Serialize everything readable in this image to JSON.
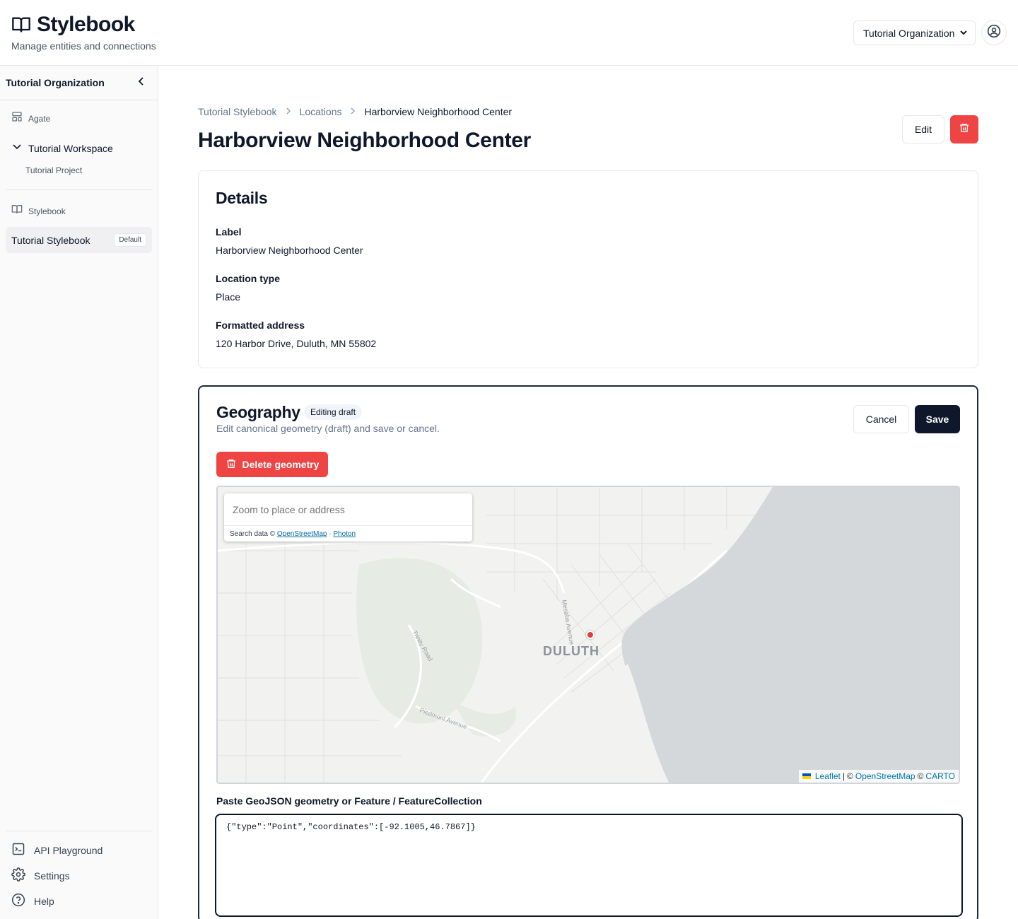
{
  "header": {
    "app_title": "Stylebook",
    "app_subtitle": "Manage entities and connections",
    "org_select_value": "Tutorial Organization"
  },
  "sidebar": {
    "org_name": "Tutorial Organization",
    "agate_label": "Agate",
    "workspace_label": "Tutorial Workspace",
    "project_label": "Tutorial Project",
    "stylebook_label": "Stylebook",
    "active_stylebook": "Tutorial Stylebook",
    "active_badge": "Default",
    "bottom_nav": [
      {
        "label": "API Playground",
        "icon": "terminal-icon"
      },
      {
        "label": "Settings",
        "icon": "gear-icon"
      },
      {
        "label": "Help",
        "icon": "help-icon"
      }
    ]
  },
  "breadcrumb": [
    "Tutorial Stylebook",
    "Locations",
    "Harborview Neighborhood Center"
  ],
  "page": {
    "title": "Harborview Neighborhood Center",
    "edit_label": "Edit"
  },
  "details": {
    "title": "Details",
    "fields": [
      {
        "label": "Label",
        "value": "Harborview Neighborhood Center"
      },
      {
        "label": "Location type",
        "value": "Place"
      },
      {
        "label": "Formatted address",
        "value": "120 Harbor Drive, Duluth, MN 55802"
      }
    ]
  },
  "geography": {
    "title": "Geography",
    "badge": "Editing draft",
    "subtitle": "Edit canonical geometry (draft) and save or cancel.",
    "cancel_label": "Cancel",
    "save_label": "Save",
    "delete_label": "Delete geometry",
    "map": {
      "search_placeholder": "Zoom to place or address",
      "search_credit_prefix": "Search data ©",
      "search_credit_osm": "OpenStreetMap",
      "search_credit_sep": "·",
      "search_credit_photon": "Photon",
      "city_label": "DULUTH",
      "street_labels": [
        "Trinity Road",
        "Piedmont Avenue",
        "Mesaba Avenue"
      ],
      "attribution": {
        "leaflet": "Leaflet",
        "sep": "|",
        "copy": "©",
        "osm": "OpenStreetMap",
        "copy2": "©",
        "carto": "CARTO"
      }
    },
    "textarea_label": "Paste GeoJSON geometry or Feature / FeatureCollection",
    "geojson": "{\"type\":\"Point\",\"coordinates\":[-92.1005,46.7867]}"
  },
  "colors": {
    "danger": "#ef4444",
    "primary": "#0f172a",
    "marker": "#e03c3c",
    "water": "#d4d8db"
  }
}
